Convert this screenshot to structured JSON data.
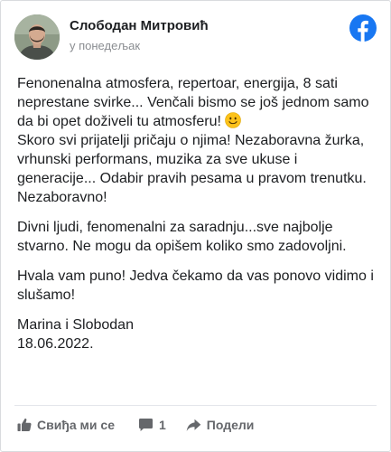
{
  "post": {
    "author": "Слободан Митровић",
    "timestamp": "у понедељак",
    "logo_icon": "facebook-logo-icon",
    "paragraph_1": "Fenonenalna atmosfera, repertoar, energija, 8 sati neprestane svirke... Venčali bismo se još jednom samo da bi opet doživeli tu atmosferu!",
    "emoji": "slightly-smiling-face-emoji",
    "paragraph_1b": "Skoro svi prijatelji pričaju o njima! Nezaboravna žurka, vrhunski performans, muzika za sve ukuse i generacije... Odabir pravih pesama u pravom trenutku. Nezaboravno!",
    "paragraph_2": "Divni ljudi, fenomenalni za saradnju...sve najbolje stvarno. Ne mogu da opišem koliko smo zadovoljni.",
    "paragraph_3": "Hvala vam puno! Jedva čekamo da vas ponovo vidimo i slušamo!",
    "signature_names": "Marina i Slobodan",
    "signature_date": "18.06.2022."
  },
  "actions": {
    "like_label": "Свиђа ми се",
    "like_icon": "thumbs-up-icon",
    "comment_count": "1",
    "comment_icon": "comment-icon",
    "share_label": "Подели",
    "share_icon": "share-arrow-icon"
  },
  "colors": {
    "facebook_blue": "#1877f2",
    "text": "#1c1e21",
    "muted": "#65676b",
    "timestamp": "#8a8d91"
  }
}
